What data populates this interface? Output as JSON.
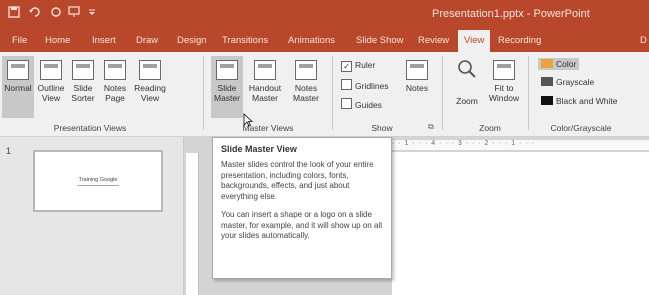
{
  "app": {
    "title": "Presentation1.pptx - PowerPoint"
  },
  "qat": {
    "save_icon": "save-icon",
    "undo_icon": "undo-icon",
    "redo_icon": "redo-icon",
    "slideshow_icon": "slideshow-icon",
    "more_icon": "customize-qat-icon"
  },
  "tabs": [
    {
      "label": "File"
    },
    {
      "label": "Home"
    },
    {
      "label": "Insert"
    },
    {
      "label": "Draw"
    },
    {
      "label": "Design"
    },
    {
      "label": "Transitions"
    },
    {
      "label": "Animations"
    },
    {
      "label": "Slide Show"
    },
    {
      "label": "Review"
    },
    {
      "label": "View"
    },
    {
      "label": "Recording"
    },
    {
      "label": "D"
    }
  ],
  "ribbon": {
    "presentation_views": {
      "label": "Presentation Views",
      "buttons": [
        {
          "line1": "Normal",
          "line2": ""
        },
        {
          "line1": "Outline",
          "line2": "View"
        },
        {
          "line1": "Slide",
          "line2": "Sorter"
        },
        {
          "line1": "Notes",
          "line2": "Page"
        },
        {
          "line1": "Reading",
          "line2": "View"
        }
      ]
    },
    "master_views": {
      "label": "Master Views",
      "buttons": [
        {
          "line1": "Slide",
          "line2": "Master"
        },
        {
          "line1": "Handout",
          "line2": "Master"
        },
        {
          "line1": "Notes",
          "line2": "Master"
        }
      ]
    },
    "show": {
      "label": "Show",
      "checks": [
        {
          "label": "Ruler",
          "checked": true
        },
        {
          "label": "Gridlines",
          "checked": false
        },
        {
          "label": "Guides",
          "checked": false
        }
      ],
      "notes_button": "Notes"
    },
    "zoom": {
      "label": "Zoom",
      "zoom_button": "Zoom",
      "fit_line1": "Fit to",
      "fit_line2": "Window"
    },
    "color": {
      "label": "Color/Grayscale",
      "options": [
        {
          "label": "Color",
          "color": "#e8a33a",
          "selected": true
        },
        {
          "label": "Grayscale",
          "color": "#555555",
          "selected": false
        },
        {
          "label": "Black and White",
          "color": "#111111",
          "selected": false
        }
      ]
    }
  },
  "slides": {
    "number": "1",
    "thumb_title": "Training Google"
  },
  "ruler": {
    "marks": "· · 1 · · · 4 · · · 3 · · · 2 · · · 1 · · ·"
  },
  "tooltip": {
    "title": "Slide Master View",
    "para1": "Master slides control the look of your entire presentation, including colors, fonts, backgrounds, effects, and just about everything else.",
    "para2": "You can insert a shape or a logo on a slide master, for example, and it will show up on all your slides automatically."
  },
  "colors": {
    "accent": "#b8472c",
    "ribbon_bg": "#f0f0f0"
  }
}
